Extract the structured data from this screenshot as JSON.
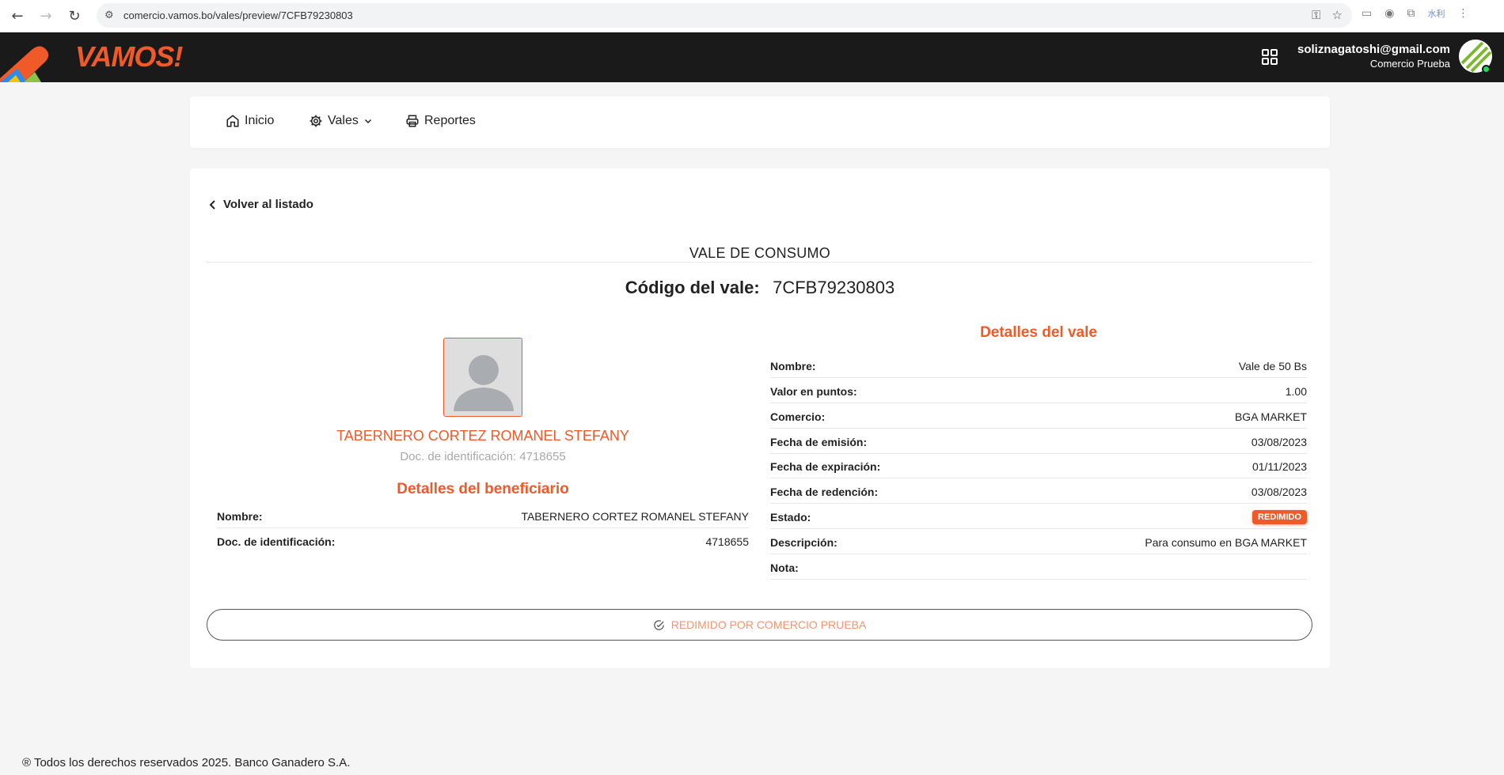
{
  "browser": {
    "url": "comercio.vamos.bo/vales/preview/7CFB79230803",
    "ext_label": "水利"
  },
  "header": {
    "logo": "VAMOS!",
    "user_email": "soliznagatoshi@gmail.com",
    "user_company": "Comercio Prueba"
  },
  "nav": {
    "home": "Inicio",
    "vouchers": "Vales",
    "reports": "Reportes"
  },
  "page": {
    "back": "Volver al listado",
    "title": "VALE DE CONSUMO",
    "code_label": "Código del vale:",
    "code_value": "7CFB79230803"
  },
  "beneficiary": {
    "name": "TABERNERO CORTEZ ROMANEL STEFANY",
    "doc_line": "Doc. de identificación: 4718655",
    "heading": "Detalles del beneficiario",
    "rows": [
      {
        "label": "Nombre:",
        "value": "TABERNERO CORTEZ ROMANEL STEFANY"
      },
      {
        "label": "Doc. de identificación:",
        "value": "4718655"
      }
    ]
  },
  "voucher": {
    "heading": "Detalles del vale",
    "rows": [
      {
        "label": "Nombre:",
        "value": "Vale de 50 Bs"
      },
      {
        "label": "Valor en puntos:",
        "value": "1.00"
      },
      {
        "label": "Comercio:",
        "value": "BGA MARKET"
      },
      {
        "label": "Fecha de emisión:",
        "value": "03/08/2023"
      },
      {
        "label": "Fecha de expiración:",
        "value": "01/11/2023"
      },
      {
        "label": "Fecha de redención:",
        "value": "03/08/2023"
      },
      {
        "label": "Estado:",
        "value": "REDIMIDO"
      },
      {
        "label": "Descripción:",
        "value": "Para consumo en BGA MARKET"
      },
      {
        "label": "Nota:",
        "value": ""
      }
    ]
  },
  "action": {
    "redeemed_label": "REDIMIDO POR COMERCIO PRUEBA"
  },
  "footer": {
    "text": "® Todos los derechos reservados 2025. Banco Ganadero S.A."
  },
  "colors": {
    "brand": "#f05a28",
    "header_bg": "#1a1a1a",
    "page_bg": "#f5f5f5"
  }
}
